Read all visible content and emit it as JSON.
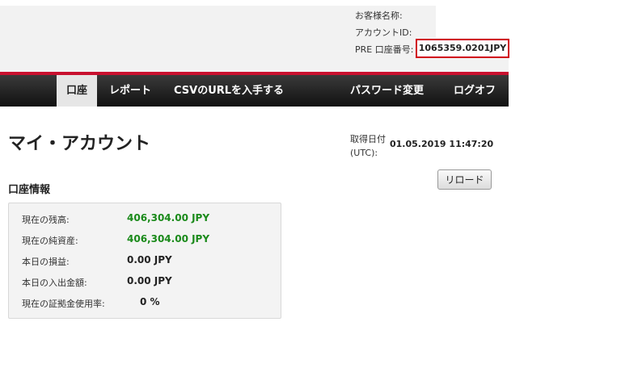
{
  "header": {
    "customer_name_label": "お客様名称:",
    "account_id_label": "アカウントID:",
    "account_number_label": "PRE 口座番号:",
    "account_number_value": "1065359.0201JPY"
  },
  "nav": {
    "items": [
      {
        "label": "口座"
      },
      {
        "label": "レポート"
      },
      {
        "label": "CSVのURLを入手する"
      },
      {
        "label": "パスワード変更"
      },
      {
        "label": "ログオフ"
      }
    ],
    "accent_color": "#c8102e"
  },
  "main": {
    "title": "マイ・アカウント",
    "date_label_line1": "取得日付",
    "date_label_line2": "(UTC):",
    "date_value": "01.05.2019 11:47:20",
    "reload_label": "リロード",
    "section_title": "口座情報",
    "rows": [
      {
        "label": "現在の残高:",
        "value": "406,304.00 JPY",
        "color": "#1a8a1a"
      },
      {
        "label": "現在の純資産:",
        "value": "406,304.00 JPY",
        "color": "#1a8a1a"
      },
      {
        "label": "本日の損益:",
        "value": "0.00 JPY",
        "color": "#222222"
      },
      {
        "label": "本日の入出金額:",
        "value": "0.00 JPY",
        "color": "#222222"
      },
      {
        "label": "現在の証拠金使用率:",
        "value": "0 %",
        "color": "#222222"
      }
    ]
  }
}
